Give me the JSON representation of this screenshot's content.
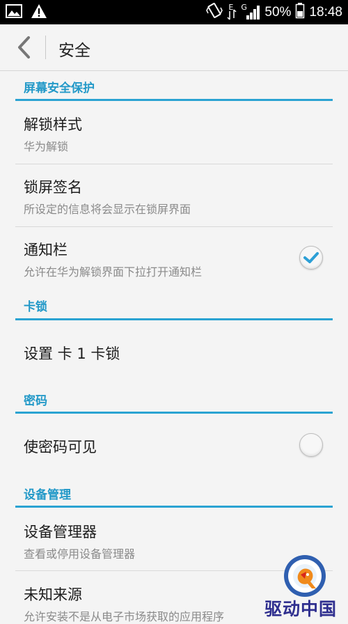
{
  "status_bar": {
    "battery_text": "50%",
    "time": "18:48",
    "network_e": "E",
    "network_g": "G"
  },
  "header": {
    "title": "安全"
  },
  "sections": [
    {
      "header": "屏幕安全保护"
    },
    {
      "header": "卡锁"
    },
    {
      "header": "密码"
    },
    {
      "header": "设备管理"
    }
  ],
  "items": {
    "unlock_style": {
      "title": "解锁样式",
      "subtitle": "华为解锁"
    },
    "lock_signature": {
      "title": "锁屏签名",
      "subtitle": "所设定的信息将会显示在锁屏界面"
    },
    "notification_bar": {
      "title": "通知栏",
      "subtitle": "允许在华为解锁界面下拉打开通知栏",
      "checked": true
    },
    "sim_lock": {
      "title": "设置 卡 1 卡锁"
    },
    "show_password": {
      "title": "使密码可见",
      "checked": false
    },
    "device_admin": {
      "title": "设备管理器",
      "subtitle": "查看或停用设备管理器"
    },
    "unknown_sources": {
      "title": "未知来源",
      "subtitle": "允许安装不是从电子市场获取的应用程序"
    }
  },
  "watermark": {
    "text": "驱动中国"
  },
  "colors": {
    "accent": "#2aa3d2",
    "check": "#2c9fd6"
  }
}
